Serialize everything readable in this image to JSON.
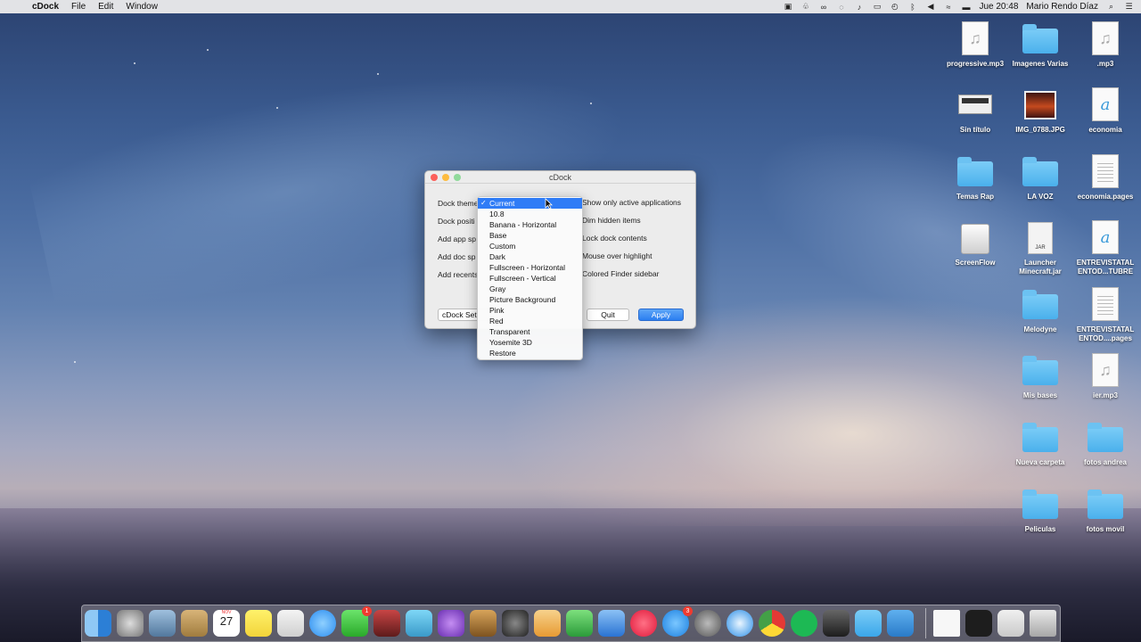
{
  "menubar": {
    "apple_icon": "",
    "app_name": "cDock",
    "menus": [
      "File",
      "Edit",
      "Window"
    ],
    "clock": "Jue 20:48",
    "user": "Mario Rendo Díaz",
    "status_icons": [
      "screen-record-icon",
      "evernote-icon",
      "creative-cloud-icon",
      "messages-icon",
      "notification-icon",
      "airplay-icon",
      "time-machine-icon",
      "bluetooth-icon",
      "volume-icon",
      "wifi-icon",
      "flag-icon",
      "spotlight-icon",
      "notification-center-icon"
    ]
  },
  "desktop_icons": [
    {
      "label": "progressive.mp3",
      "kind": "music"
    },
    {
      "label": "Imagenes Varias",
      "kind": "folder"
    },
    {
      "label": ".mp3",
      "kind": "music"
    },
    {
      "label": "Sin título",
      "kind": "screenshot"
    },
    {
      "label": "IMG_0788.JPG",
      "kind": "photo"
    },
    {
      "label": "economia",
      "kind": "doc"
    },
    {
      "label": "Temas Rap",
      "kind": "folder"
    },
    {
      "label": "LA VOZ",
      "kind": "folder"
    },
    {
      "label": "economia.pages",
      "kind": "pages"
    },
    {
      "label": "ScreenFlow",
      "kind": "drive"
    },
    {
      "label": "Launcher Minecraft.jar",
      "kind": "jar"
    },
    {
      "label": "ENTREVISTATAL ENTOD...TUBRE",
      "kind": "doc"
    },
    {
      "label": "Melodyne",
      "kind": "folder"
    },
    {
      "label": "ENTREVISTATAL ENTOD....pages",
      "kind": "pages"
    },
    {
      "label": "Mis bases",
      "kind": "folder"
    },
    {
      "label": "ier.mp3",
      "kind": "music"
    },
    {
      "label": "Nueva carpeta",
      "kind": "folder"
    },
    {
      "label": "fotos andrea",
      "kind": "folder"
    },
    {
      "label": "Peliculas",
      "kind": "folder"
    },
    {
      "label": "fotos movil",
      "kind": "folder"
    }
  ],
  "window": {
    "title": "cDock",
    "labels": {
      "dock_theme": "Dock theme",
      "dock_position": "Dock positi",
      "add_app_spacer": "Add app sp",
      "add_doc_spacer": "Add doc sp",
      "add_recents": "Add recents"
    },
    "checkboxes": {
      "show_active": "Show only active applications",
      "dim_hidden": "Dim hidden items",
      "lock_dock": "Lock dock contents",
      "mouse_highlight": "Mouse over highlight",
      "colored_sidebar": "Colored Finder sidebar"
    },
    "buttons": {
      "settings": "cDock Set",
      "quit": "Quit",
      "apply": "Apply"
    }
  },
  "theme_dropdown": {
    "check_mark": "✓",
    "selected": "Current",
    "options": [
      "Current",
      "10.8",
      "Banana - Horizontal",
      "Base",
      "Custom",
      "Dark",
      "Fullscreen - Horizontal",
      "Fullscreen - Vertical",
      "Gray",
      "Picture Background",
      "Pink",
      "Red",
      "Transparent",
      "Yosemite 3D",
      "Restore"
    ]
  },
  "dock": {
    "calendar_month": "NOV",
    "calendar_day": "27",
    "facetime_badge": "1",
    "appstore_badge": "3",
    "apps": [
      "finder-icon",
      "launchpad-icon",
      "preview-icon",
      "contacts-icon",
      "calendar-icon",
      "notes-icon",
      "reminders-icon",
      "messages-icon",
      "facetime-icon",
      "photo-booth-icon",
      "iphoto-icon",
      "imovie-icon",
      "garageband-icon",
      "dvd-player-icon",
      "pages-icon",
      "numbers-icon",
      "keynote-icon",
      "itunes-icon",
      "app-store-icon",
      "system-preferences-icon",
      "safari-icon",
      "chrome-icon",
      "spotify-icon",
      "final-cut-icon",
      "folder-icon",
      "screenflow-icon",
      "documents-icon",
      "terminal-icon",
      "preview-docs-icon",
      "trash-icon"
    ]
  }
}
